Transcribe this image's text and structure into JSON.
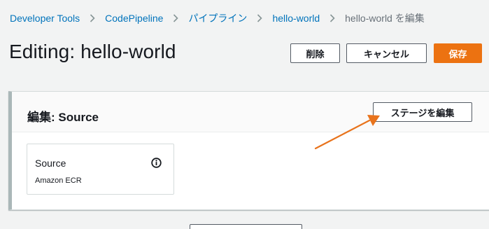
{
  "breadcrumb": {
    "items": [
      "Developer Tools",
      "CodePipeline",
      "パイプライン",
      "hello-world"
    ],
    "current": "hello-world を編集"
  },
  "header": {
    "title": "Editing: hello-world",
    "delete_label": "削除",
    "cancel_label": "キャンセル",
    "save_label": "保存"
  },
  "stage": {
    "title": "編集: Source",
    "edit_stage_label": "ステージを編集",
    "action": {
      "name": "Source",
      "provider": "Amazon ECR",
      "icon": "info-icon"
    }
  },
  "colors": {
    "primary": "#ec7211",
    "link": "#0073bb",
    "annotation_arrow": "#e8731c"
  }
}
